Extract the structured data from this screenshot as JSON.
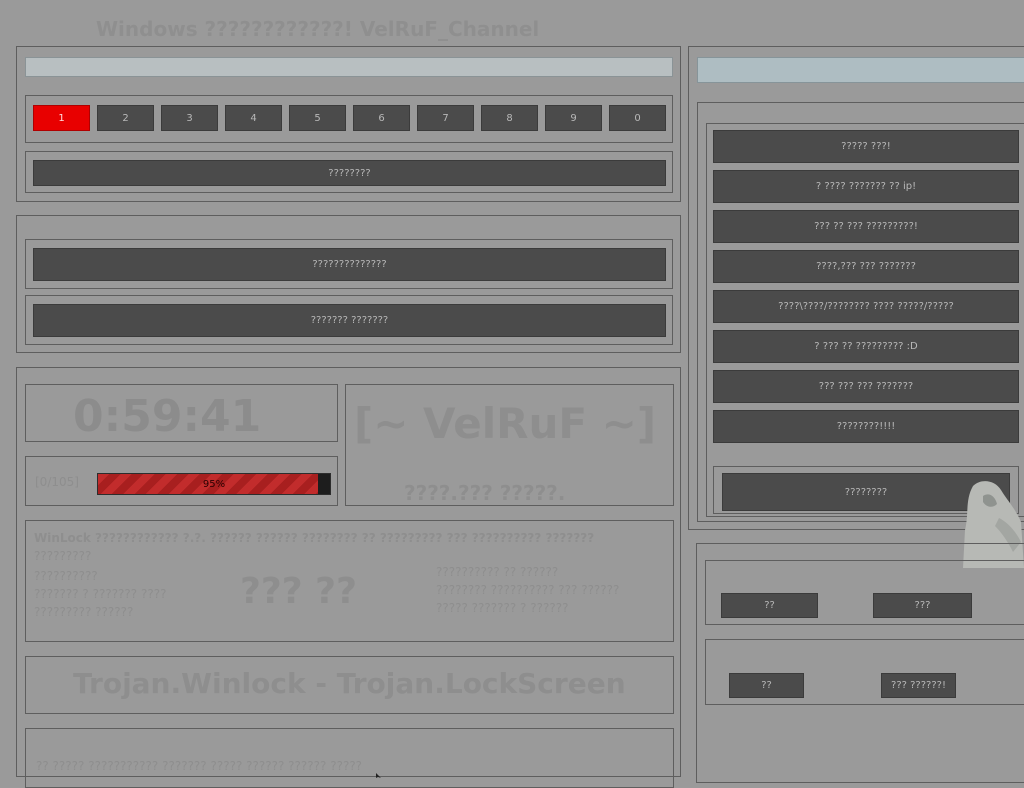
{
  "window_title": "Windows ????????????! VelRuF_Channel",
  "page_numbers": [
    "1",
    "2",
    "3",
    "4",
    "5",
    "6",
    "7",
    "8",
    "9",
    "0"
  ],
  "active_page": "1",
  "left_top": {
    "action_button": "????????"
  },
  "section2": {
    "button1": "??????????????",
    "button2": "??????? ???????"
  },
  "timer": "0:59:41",
  "progress": {
    "label": "[0/105]",
    "percent_text": "95%",
    "value": 0.95
  },
  "brand": {
    "title": "[~ VelRuF ~]",
    "subtitle": "????.??? ?????."
  },
  "info_block": {
    "line1": "WinLock ???????????? ?.?. ?????? ?????? ???????? ?? ????????? ??? ?????????? ???????",
    "line2": "?????????",
    "left_lines": [
      "??????????",
      "??????? ? ??????? ????",
      "????????? ??????"
    ],
    "center_big": "??? ??",
    "right_lines": [
      "?????????? ?? ??????",
      "???????? ?????????? ??? ??????",
      "????? ??????? ? ??????"
    ]
  },
  "trojan_name": "Trojan.Winlock - Trojan.LockScreen",
  "bottom_partial": "?? ????? ??????????? ??????? ????? ?????? ?????? ?????",
  "right_panel": {
    "buttons": [
      "????? ???!",
      "? ???? ??????? ?? ip!",
      "??? ?? ??? ?????????!",
      "????,??? ??? ???????",
      "????\\????/???????? ???? ?????/?????",
      "? ??? ?? ????????? :D",
      "??? ??? ??? ???????",
      "????????!!!!"
    ],
    "extra_button": "????????"
  },
  "lower_right": {
    "group1": {
      "btn_a": "??",
      "btn_b": "???"
    },
    "group2": {
      "btn_a": "??",
      "btn_b": "??? ??????!"
    }
  }
}
